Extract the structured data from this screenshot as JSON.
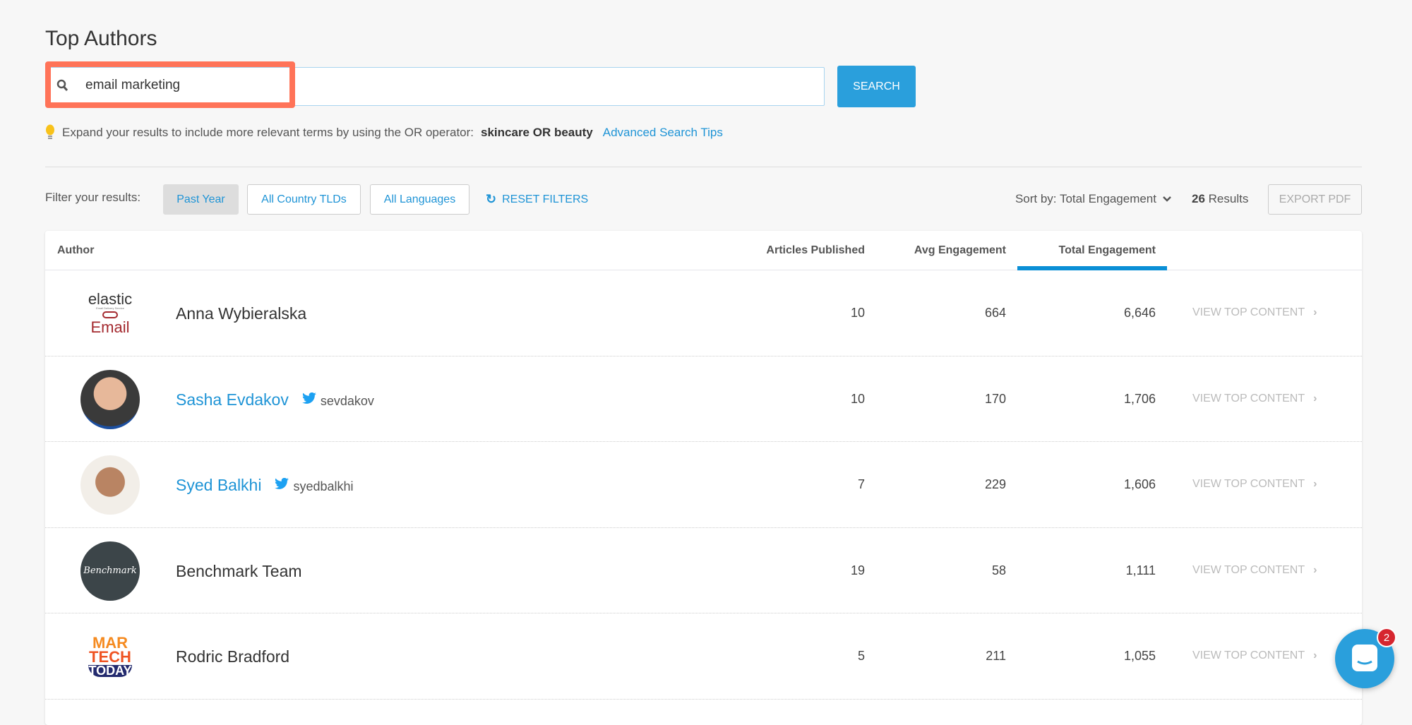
{
  "page": {
    "title": "Top Authors"
  },
  "search": {
    "value": "email marketing",
    "button": "SEARCH"
  },
  "tip": {
    "text": "Expand your results to include more relevant terms by using the OR operator:",
    "example": "skincare OR beauty",
    "link": "Advanced Search Tips"
  },
  "filters": {
    "label": "Filter your results:",
    "date": "Past Year",
    "country": "All Country TLDs",
    "language": "All Languages",
    "reset": "RESET FILTERS"
  },
  "sort": {
    "label": "Sort by: Total Engagement",
    "count": "26",
    "results_label": "Results",
    "export": "EXPORT PDF"
  },
  "table": {
    "headers": {
      "author": "Author",
      "articles": "Articles Published",
      "avg": "Avg Engagement",
      "total": "Total Engagement"
    },
    "view_label": "VIEW TOP CONTENT",
    "rows": [
      {
        "name": "Anna Wybieralska",
        "twitter": "",
        "articles": "10",
        "avg": "664",
        "total": "6,646",
        "logo": "Elastic Email"
      },
      {
        "name": "Sasha Evdakov",
        "twitter": "sevdakov",
        "articles": "10",
        "avg": "170",
        "total": "1,706"
      },
      {
        "name": "Syed Balkhi",
        "twitter": "syedbalkhi",
        "articles": "7",
        "avg": "229",
        "total": "1,606"
      },
      {
        "name": "Benchmark Team",
        "twitter": "",
        "articles": "19",
        "avg": "58",
        "total": "1,111",
        "logo": "Benchmark"
      },
      {
        "name": "Rodric Bradford",
        "twitter": "",
        "articles": "5",
        "avg": "211",
        "total": "1,055",
        "logo": "MarTech Today"
      }
    ]
  },
  "chat": {
    "badge": "2"
  },
  "colors": {
    "accent": "#2a9fdc",
    "highlight": "#ff7358",
    "badge": "#d6262f"
  }
}
